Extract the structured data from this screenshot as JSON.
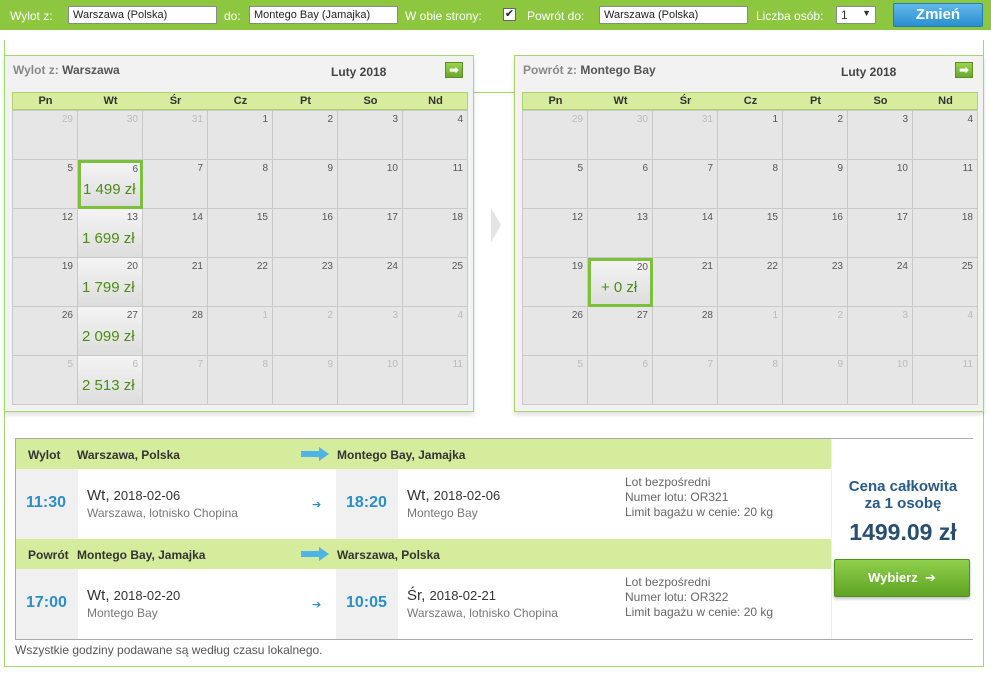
{
  "search": {
    "from_label": "Wylot z:",
    "from_value": "Warszawa (Polska)",
    "to_label": "do:",
    "to_value": "Montego Bay (Jamajka)",
    "roundtrip_label": "W obie strony:",
    "roundtrip_check": "✔",
    "return_label": "Powrót do:",
    "return_value": "Warszawa (Polska)",
    "persons_label": "Liczba osób:",
    "persons_value": "1",
    "persons_arrow": "▼",
    "change_button": "Zmień"
  },
  "weekdays": [
    "Pn",
    "Wt",
    "Śr",
    "Cz",
    "Pt",
    "So",
    "Nd"
  ],
  "outbound_calendar": {
    "title_prefix": "Wylot z:",
    "title_city": "Warszawa",
    "month": "Luty 2018",
    "nav_icon": "➡",
    "days": [
      {
        "d": "29",
        "other": true
      },
      {
        "d": "30",
        "other": true
      },
      {
        "d": "31",
        "other": true
      },
      {
        "d": "1"
      },
      {
        "d": "2"
      },
      {
        "d": "3"
      },
      {
        "d": "4"
      },
      {
        "d": "5"
      },
      {
        "d": "6",
        "price": "1 499 zł",
        "selected": true
      },
      {
        "d": "7"
      },
      {
        "d": "8"
      },
      {
        "d": "9"
      },
      {
        "d": "10"
      },
      {
        "d": "11"
      },
      {
        "d": "12"
      },
      {
        "d": "13",
        "price": "1 699 zł"
      },
      {
        "d": "14"
      },
      {
        "d": "15"
      },
      {
        "d": "16"
      },
      {
        "d": "17"
      },
      {
        "d": "18"
      },
      {
        "d": "19"
      },
      {
        "d": "20",
        "price": "1 799 zł"
      },
      {
        "d": "21"
      },
      {
        "d": "22"
      },
      {
        "d": "23"
      },
      {
        "d": "24"
      },
      {
        "d": "25"
      },
      {
        "d": "26"
      },
      {
        "d": "27",
        "price": "2 099 zł"
      },
      {
        "d": "28"
      },
      {
        "d": "1",
        "other": true
      },
      {
        "d": "2",
        "other": true
      },
      {
        "d": "3",
        "other": true
      },
      {
        "d": "4",
        "other": true
      },
      {
        "d": "5",
        "other": true
      },
      {
        "d": "6",
        "other": true,
        "price": "2 513 zł"
      },
      {
        "d": "7",
        "other": true
      },
      {
        "d": "8",
        "other": true
      },
      {
        "d": "9",
        "other": true
      },
      {
        "d": "10",
        "other": true
      },
      {
        "d": "11",
        "other": true
      }
    ]
  },
  "return_calendar": {
    "title_prefix": "Powrót z:",
    "title_city": "Montego Bay",
    "month": "Luty 2018",
    "nav_icon": "➡",
    "days": [
      {
        "d": "29",
        "other": true
      },
      {
        "d": "30",
        "other": true
      },
      {
        "d": "31",
        "other": true
      },
      {
        "d": "1"
      },
      {
        "d": "2"
      },
      {
        "d": "3"
      },
      {
        "d": "4"
      },
      {
        "d": "5"
      },
      {
        "d": "6"
      },
      {
        "d": "7"
      },
      {
        "d": "8"
      },
      {
        "d": "9"
      },
      {
        "d": "10"
      },
      {
        "d": "11"
      },
      {
        "d": "12"
      },
      {
        "d": "13"
      },
      {
        "d": "14"
      },
      {
        "d": "15"
      },
      {
        "d": "16"
      },
      {
        "d": "17"
      },
      {
        "d": "18"
      },
      {
        "d": "19"
      },
      {
        "d": "20",
        "price": "+ 0 zł",
        "selected": true
      },
      {
        "d": "21"
      },
      {
        "d": "22"
      },
      {
        "d": "23"
      },
      {
        "d": "24"
      },
      {
        "d": "25"
      },
      {
        "d": "26"
      },
      {
        "d": "27"
      },
      {
        "d": "28"
      },
      {
        "d": "1",
        "other": true
      },
      {
        "d": "2",
        "other": true
      },
      {
        "d": "3",
        "other": true
      },
      {
        "d": "4",
        "other": true
      },
      {
        "d": "5",
        "other": true
      },
      {
        "d": "6",
        "other": true
      },
      {
        "d": "7",
        "other": true
      },
      {
        "d": "8",
        "other": true
      },
      {
        "d": "9",
        "other": true
      },
      {
        "d": "10",
        "other": true
      },
      {
        "d": "11",
        "other": true
      }
    ]
  },
  "outbound": {
    "kind": "Wylot",
    "from": "Warszawa, Polska",
    "to": "Montego Bay, Jamajka",
    "dep_time": "11:30",
    "dep_day": "Wt,",
    "dep_date": "2018-02-06",
    "dep_place": "Warszawa, lotnisko Chopina",
    "arr_time": "18:20",
    "arr_day": "Wt,",
    "arr_date": "2018-02-06",
    "arr_place": "Montego Bay",
    "info1": "Lot bezpośredni",
    "info2": "Numer lotu: OR321",
    "info3": "Limit bagażu w cenie: 20 kg"
  },
  "inbound": {
    "kind": "Powrót",
    "from": "Montego Bay, Jamajka",
    "to": "Warszawa, Polska",
    "dep_time": "17:00",
    "dep_day": "Wt,",
    "dep_date": "2018-02-20",
    "dep_place": "Montego Bay",
    "arr_time": "10:05",
    "arr_day": "Śr,",
    "arr_date": "2018-02-21",
    "arr_place": "Warszawa, lotnisko Chopina",
    "info1": "Lot bezpośredni",
    "info2": "Numer lotu: OR322",
    "info3": "Limit bagażu w cenie: 20 kg"
  },
  "price": {
    "title1": "Cena całkowita",
    "title2": "za 1 osobę",
    "amount": "1499.09 zł",
    "button": "Wybierz",
    "button_icon": "➔"
  },
  "mini_arrow": "➔",
  "footnote": "Wszystkie godziny podawane są według czasu lokalnego.",
  "colors": {
    "accent_green": "#8dc63f",
    "time_blue": "#2b8fc6",
    "price_green": "#4d8c16",
    "button_blue": "#2a8ed1"
  }
}
